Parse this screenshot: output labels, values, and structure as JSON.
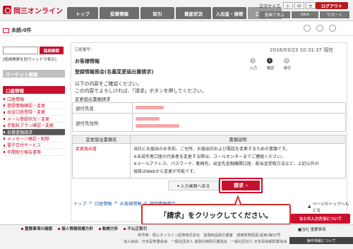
{
  "brand": {
    "name": "岡三オンライン"
  },
  "header": {
    "gnav": [
      {
        "label": "トップ",
        "active": false
      },
      {
        "label": "投資情報",
        "active": false
      },
      {
        "label": "取引",
        "active": false
      },
      {
        "label": "資産状況",
        "active": false
      },
      {
        "label": "入出金・振替",
        "active": false
      },
      {
        "label": "口座情報",
        "active": true
      }
    ],
    "font_size_label": "文字サイズ",
    "font_sizes": [
      "小",
      "中",
      "大"
    ],
    "logout": "ログアウト",
    "subnav": [
      "動画で学ぶ",
      "Q&A",
      "サポート"
    ]
  },
  "status": {
    "mail_label": "未読:0件"
  },
  "sidebar": {
    "search_button": "銘柄検索",
    "popup_link": "[銘柄検索を別ウィンドウ表示]",
    "market_cat": "マーケット情報",
    "account_cat": "口座情報",
    "items": [
      {
        "label": "口座情報",
        "selected": false
      },
      {
        "label": "登録情報確認・変更",
        "selected": false
      },
      {
        "label": "出金口座登録・変更",
        "selected": false
      },
      {
        "label": "メール登録状況・変更",
        "selected": false
      },
      {
        "label": "手数料プラン確認・変更",
        "selected": false
      },
      {
        "label": "各種書類請求",
        "selected": true
      },
      {
        "label": "メッセージ確認・削除",
        "selected": false
      },
      {
        "label": "電子交付サービス",
        "selected": false
      },
      {
        "label": "年間取引報告書等",
        "selected": false
      }
    ]
  },
  "main": {
    "account_no_label": "口座番号：",
    "datetime": "2016/03/23 10:31:37 現在",
    "section_title": "お客様情報",
    "page_title": "登録情報照会(名義変更届出書請求)",
    "steps": [
      {
        "num": "1",
        "label": "入力",
        "on": false
      },
      {
        "num": "2",
        "label": "確認",
        "on": true
      },
      {
        "num": "3",
        "label": "受付",
        "on": false
      }
    ],
    "desc_line1": "以下の内容をご確認ください。",
    "desc_line2": "この内容でよろしければ、「請求」ボタンを押してください。",
    "table_caption": "変更届出書類請求",
    "rows": [
      {
        "label": "送付先名"
      },
      {
        "label": "送付先住所"
      }
    ],
    "t2_headers": [
      "変更届出書類名",
      "書類説明"
    ],
    "t2_name": "変更届出書",
    "t2_desc": [
      "当社にお届出のお名前、ご住所、お届出印および電話を変更するための書類です。",
      "※未成年者口座の代表者を変更する際は、コールセンターまでご連絡ください。",
      "※メールアドレス、パスワード、勤務先、出金先金融機関口座、配当金受取方法など、上記以外の",
      "項目はWebから変更が可能です。"
    ],
    "back_button": "入力画面へ戻る",
    "submit_button": "請求",
    "breadcrumb": [
      "トップ",
      "口座情報",
      "お客様情報",
      "登録情報照会"
    ],
    "page_top": "ページのトップへもどる",
    "callout": "「請求」をクリックしてください。",
    "side_button": "なとの入力方法について"
  },
  "footer": {
    "links": [
      "重要事項の確認",
      "個人情報保護方針",
      "勧誘方針",
      "不公正取引"
    ],
    "right": "■当社 重要事項",
    "copy1": "商号等：岡三オンライン証券株式会社　金融商品取引業者　関東財務局長(金商)第52号",
    "copy2": "加入協会：日本証券業協会　一般社団法人 金融先物取引業協会　一般社団法人 日本投資顧問業協会",
    "status": "操作情報について"
  },
  "colors": {
    "accent": "#c8102e",
    "nav": "#6e6e6e"
  }
}
